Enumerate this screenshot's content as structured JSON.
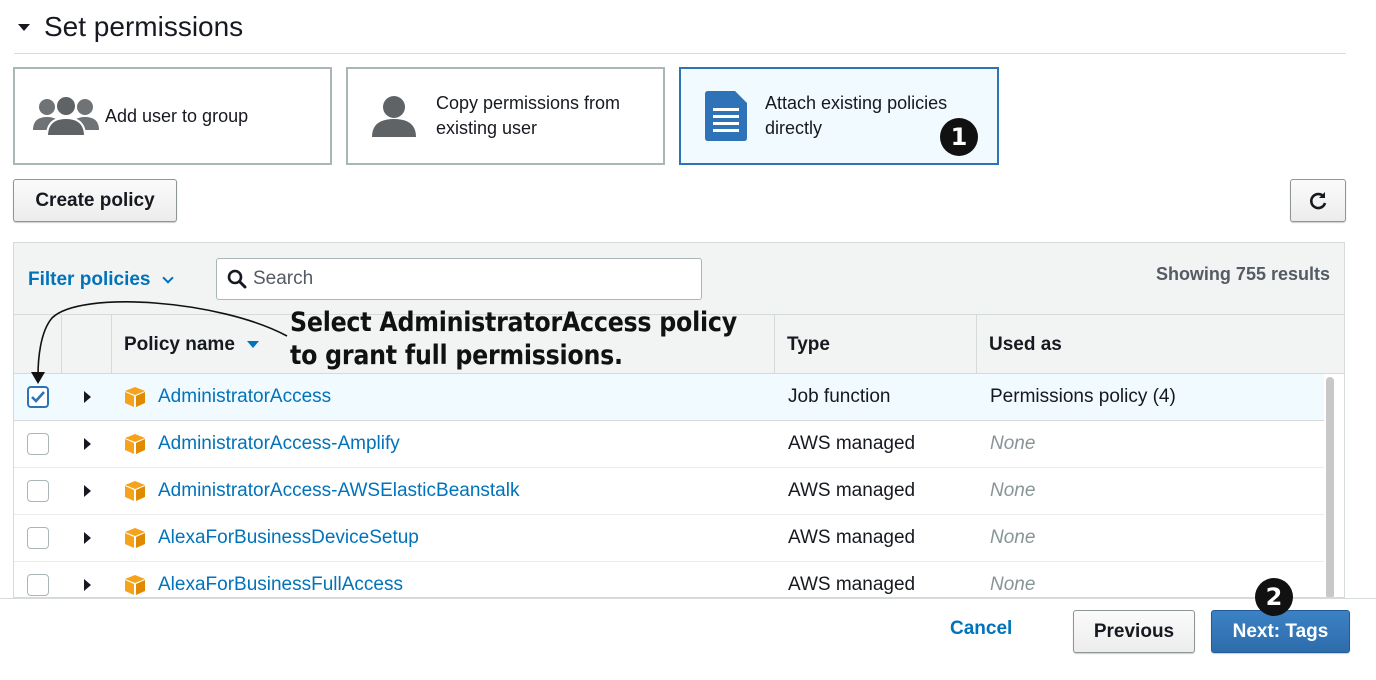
{
  "section": {
    "title": "Set permissions"
  },
  "options": [
    {
      "label_line1": "Add user to group",
      "label_line2": "",
      "icon": "users-group-icon"
    },
    {
      "label_line1": "Copy permissions from",
      "label_line2": "existing user",
      "icon": "user-icon"
    },
    {
      "label_line1": "Attach existing policies",
      "label_line2": "directly",
      "icon": "document-icon"
    }
  ],
  "buttons": {
    "create_policy": "Create policy",
    "refresh_icon": "refresh-icon"
  },
  "toolbar": {
    "filter_label": "Filter policies",
    "search_placeholder": "Search",
    "results_text": "Showing 755 results"
  },
  "table": {
    "headers": {
      "policy_name": "Policy name",
      "type": "Type",
      "used_as": "Used as"
    },
    "rows": [
      {
        "checked": true,
        "name": "AdministratorAccess",
        "type": "Job function",
        "used_as": "Permissions policy (4)",
        "used_as_none": false
      },
      {
        "checked": false,
        "name": "AdministratorAccess-Amplify",
        "type": "AWS managed",
        "used_as": "None",
        "used_as_none": true
      },
      {
        "checked": false,
        "name": "AdministratorAccess-AWSElasticBeanstalk",
        "type": "AWS managed",
        "used_as": "None",
        "used_as_none": true
      },
      {
        "checked": false,
        "name": "AlexaForBusinessDeviceSetup",
        "type": "AWS managed",
        "used_as": "None",
        "used_as_none": true
      },
      {
        "checked": false,
        "name": "AlexaForBusinessFullAccess",
        "type": "AWS managed",
        "used_as": "None",
        "used_as_none": true
      }
    ]
  },
  "annotations": {
    "callout_line1": "Select AdministratorAccess policy",
    "callout_line2": "to grant full permissions.",
    "badge1": "1",
    "badge2": "2"
  },
  "footer": {
    "cancel": "Cancel",
    "previous": "Previous",
    "next": "Next: Tags"
  },
  "colors": {
    "link": "#0073bb",
    "primary": "#2e73b8",
    "policy_icon": "#f7a21b"
  }
}
